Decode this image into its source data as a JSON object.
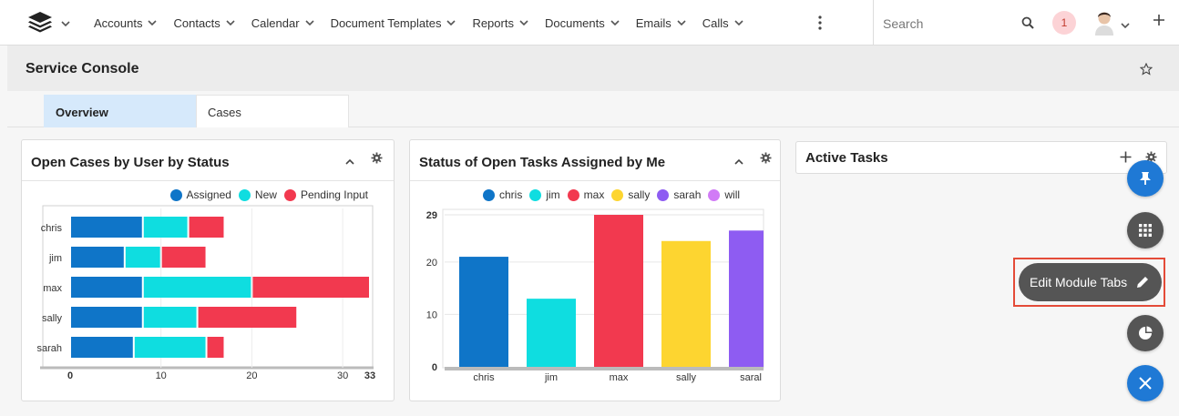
{
  "nav": {
    "items": [
      {
        "label": "Accounts"
      },
      {
        "label": "Contacts"
      },
      {
        "label": "Calendar"
      },
      {
        "label": "Document Templates"
      },
      {
        "label": "Reports"
      },
      {
        "label": "Documents"
      },
      {
        "label": "Emails"
      },
      {
        "label": "Calls"
      }
    ],
    "search_placeholder": "Search",
    "notification_count": "1"
  },
  "header": {
    "title": "Service Console"
  },
  "tabs": [
    {
      "label": "Overview",
      "active": true
    },
    {
      "label": "Cases",
      "active": false
    }
  ],
  "dashlets": {
    "cases": {
      "title": "Open Cases by User by Status",
      "legend": [
        {
          "label": "Assigned",
          "color": "#0f75c8"
        },
        {
          "label": "New",
          "color": "#0fdde0"
        },
        {
          "label": "Pending Input",
          "color": "#f2394f"
        }
      ]
    },
    "tasks": {
      "title": "Status of Open Tasks Assigned by Me",
      "legend": [
        {
          "label": "chris",
          "color": "#0f75c8"
        },
        {
          "label": "jim",
          "color": "#0fdde0"
        },
        {
          "label": "max",
          "color": "#f2394f"
        },
        {
          "label": "sally",
          "color": "#fdd530"
        },
        {
          "label": "sarah",
          "color": "#8e5cf2"
        },
        {
          "label": "will",
          "color": "#d17bf6"
        }
      ]
    },
    "active": {
      "title": "Active Tasks"
    }
  },
  "fab": {
    "edit_tabs_label": "Edit Module Tabs"
  },
  "chart_data": [
    {
      "type": "bar",
      "orientation": "horizontal",
      "stacked": true,
      "categories": [
        "chris",
        "jim",
        "max",
        "sally",
        "sarah"
      ],
      "series": [
        {
          "name": "Assigned",
          "values": [
            8,
            6,
            8,
            8,
            7
          ]
        },
        {
          "name": "New",
          "values": [
            5,
            4,
            12,
            6,
            8
          ]
        },
        {
          "name": "Pending Input",
          "values": [
            4,
            5,
            13,
            11,
            2
          ]
        }
      ],
      "xlim": [
        0,
        33
      ],
      "xticks": [
        "0",
        "10",
        "20",
        "30",
        "33"
      ],
      "legend": "top-right"
    },
    {
      "type": "bar",
      "categories": [
        "chris",
        "jim",
        "max",
        "sally",
        "saral"
      ],
      "values": [
        21,
        13,
        29,
        24,
        26
      ],
      "ylim": [
        0,
        29
      ],
      "yticks": [
        "0",
        "10",
        "20",
        "29"
      ],
      "legend": "top"
    }
  ]
}
